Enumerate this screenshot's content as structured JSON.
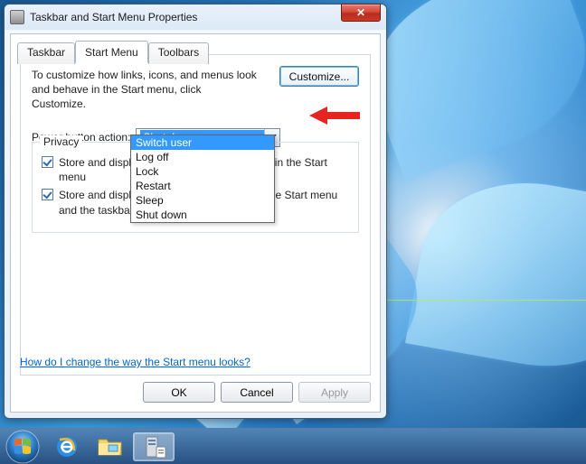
{
  "window": {
    "title": "Taskbar and Start Menu Properties",
    "close_glyph": "✕"
  },
  "tabs": {
    "taskbar": "Taskbar",
    "start_menu": "Start Menu",
    "toolbars": "Toolbars"
  },
  "panel": {
    "intro": "To customize how links, icons, and menus look and behave in the Start menu, click Customize.",
    "customize": "Customize...",
    "power_label": "Power button action:",
    "power_selected": "Shut down",
    "dropdown_options": [
      "Switch user",
      "Log off",
      "Lock",
      "Restart",
      "Sleep",
      "Shut down"
    ],
    "dropdown_highlighted": "Switch user",
    "privacy_legend": "Privacy",
    "priv1": "Store and display recently opened programs in the Start menu",
    "priv2": "Store and display recently opened items in the Start menu and the taskbar",
    "help_link": "How do I change the way the Start menu looks?"
  },
  "buttons": {
    "ok": "OK",
    "cancel": "Cancel",
    "apply": "Apply"
  },
  "taskbar": {
    "start": "Start",
    "ie": "Internet Explorer",
    "explorer": "Windows Explorer",
    "properties": "Taskbar and Start Menu Properties"
  }
}
